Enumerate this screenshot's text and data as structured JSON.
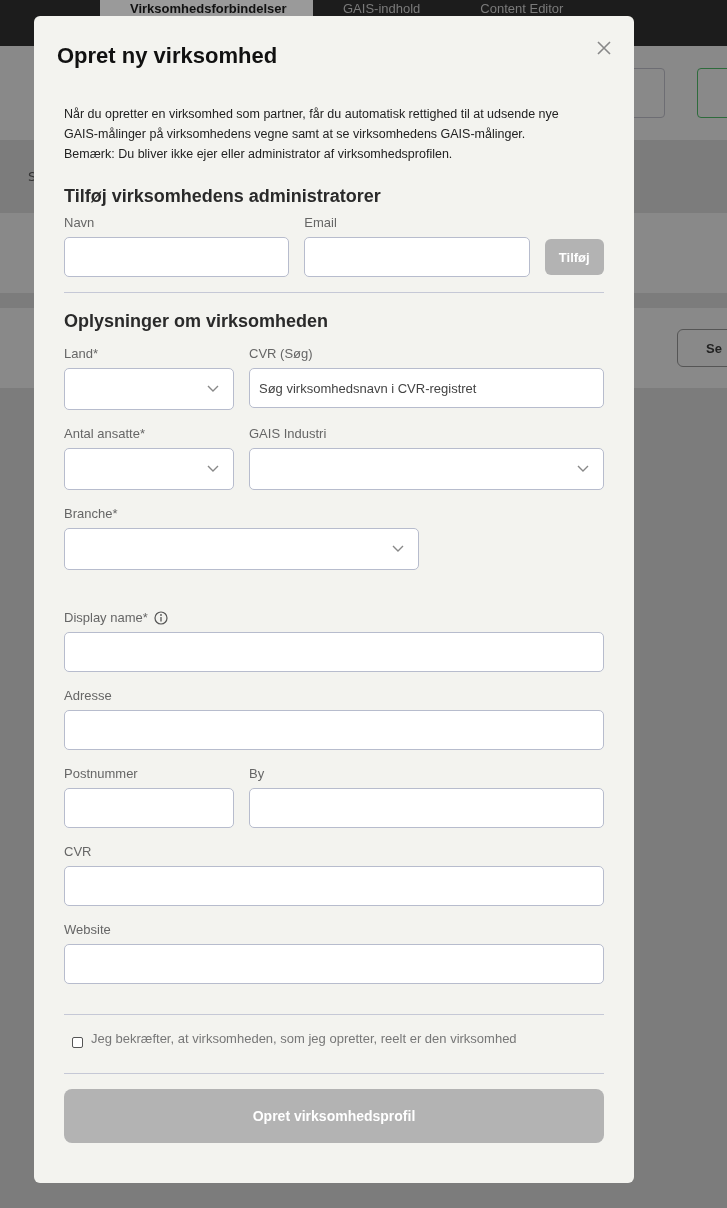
{
  "background": {
    "tabs": [
      {
        "label": "Virksomhedsforbindelser",
        "selected": true
      },
      {
        "label": "GAIS-indhold",
        "selected": false
      },
      {
        "label": "Content Editor",
        "selected": false
      }
    ],
    "row_label": "S",
    "button": "Se"
  },
  "dialog": {
    "title": "Opret ny virksomhed",
    "intro": [
      "Når du opretter en virksomhed som partner, får du automatisk rettighed til at udsende nye GAIS-målinger på virksomhedens vegne samt at se virksomhedens GAIS-målinger.",
      "Bemærk: Du bliver ikke ejer eller administrator af virksomhedsprofilen."
    ],
    "admins": {
      "heading": "Tilføj virksomhedens administratorer",
      "fields": [
        {
          "label": "Navn"
        },
        {
          "label": "Email"
        }
      ],
      "add_button": {
        "label": "Tilføj",
        "disabled": true
      }
    },
    "company": {
      "heading": "Oplysninger om virksomheden",
      "rows": [
        [
          {
            "label": "Land*",
            "kind": "select"
          },
          {
            "label": "CVR (Søg)",
            "kind": "text",
            "placeholder": "Søg virksomhedsnavn i CVR-registret"
          }
        ],
        [
          {
            "label": "Antal ansatte*",
            "kind": "select"
          },
          {
            "label": "GAIS Industri",
            "kind": "select"
          }
        ],
        [
          {
            "label": "Branche*",
            "kind": "select"
          }
        ],
        [
          {
            "label": "Display name*",
            "kind": "text",
            "info": true
          }
        ],
        [
          {
            "label": "Adresse",
            "kind": "text"
          }
        ],
        [
          {
            "label": "Postnummer",
            "kind": "text"
          },
          {
            "label": "By",
            "kind": "text"
          }
        ],
        [
          {
            "label": "CVR",
            "kind": "text"
          }
        ],
        [
          {
            "label": "Website",
            "kind": "text"
          }
        ]
      ]
    },
    "confirm": {
      "label": "Jeg bekræfter, at virksomheden, som jeg opretter, reelt er den virksomhed",
      "checked": false
    },
    "submit": {
      "label": "Opret virksomhedsprofil",
      "disabled": true
    }
  }
}
